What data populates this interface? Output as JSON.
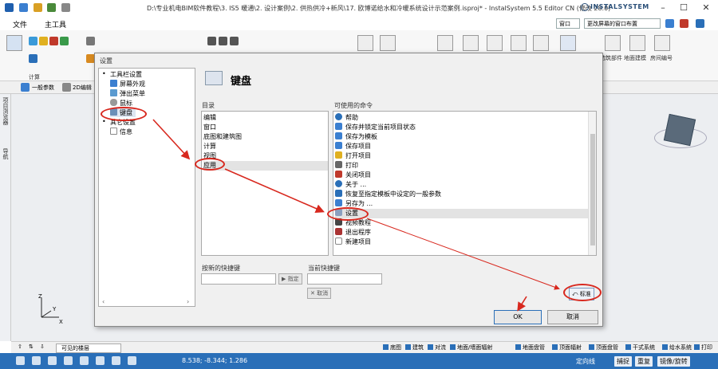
{
  "window": {
    "title": "D:\\专业机电BIM软件教程\\3. IS5 暖通\\2. 设计案例\\2. 供热供冷+新风\\17. 欧博诺给水和冷暖系统设计示范案例.isproj* - InstalSystem 5.5 Editor CN (修改 28.0)",
    "brand": "INSTALSYSTEM"
  },
  "ribbon": {
    "tabs": [
      "文件",
      "主工具"
    ],
    "window_combo": "窗口",
    "layout_combo": "更改屏幕的窗口布置",
    "group_label": "计算",
    "right_labels": [
      "选筑部件",
      "地面建模",
      "房间编号"
    ]
  },
  "toolbar2": {
    "items": [
      "一般参数",
      "2D编辑"
    ]
  },
  "leftstrip": {
    "items": [
      "项目浏览器",
      "导航"
    ]
  },
  "dialog": {
    "title": "设置",
    "panel_title": "键盘",
    "tree": [
      {
        "label": "工具栏设置",
        "type": "bullet"
      },
      {
        "label": "屏幕外观",
        "type": "icon"
      },
      {
        "label": "弹出菜单",
        "type": "icon"
      },
      {
        "label": "鼠标",
        "type": "icon"
      },
      {
        "label": "键盘",
        "type": "icon",
        "selected": true
      },
      {
        "label": "其它设置",
        "type": "bullet"
      },
      {
        "label": "信息",
        "type": "icon"
      }
    ],
    "catalog_label": "目录",
    "catalog": [
      "编辑",
      "窗口",
      "底图和建筑图",
      "计算",
      "视图",
      "应用"
    ],
    "catalog_selected": "应用",
    "commands_label": "可使用的命令",
    "commands": [
      "帮助",
      "保存并锁定当前项目状态",
      "保存为模板",
      "保存项目",
      "打开项目",
      "打印",
      "关闭项目",
      "关于 ...",
      "恢复至指定模板中设定的一般参数",
      "另存为 ...",
      "设置",
      "视频教程",
      "退出程序",
      "新建项目"
    ],
    "commands_selected": "设置",
    "new_shortcut_label": "按新的快捷键",
    "current_shortcut_label": "当前快捷键",
    "assign_button": "指定",
    "cancel_shortcut_button": "取消",
    "default_button": "标准",
    "ok_button": "OK",
    "cancel_button": "取消"
  },
  "layerbar": {
    "visible_layers": "可见的楼层",
    "layers": [
      "底图",
      "建筑",
      "对流",
      "地面/墙面辐射",
      "地面盘管",
      "顶面辐射",
      "顶面盘管",
      "干式系统",
      "给水系统",
      "打印"
    ]
  },
  "statusbar": {
    "coords": "8.538; -8.344; 1.286",
    "buttons": [
      "定向线",
      "捕捉",
      "重复",
      "镜像/旋转"
    ]
  },
  "colors": {
    "accent": "#2a6fb8",
    "annotation": "#d8281e"
  }
}
